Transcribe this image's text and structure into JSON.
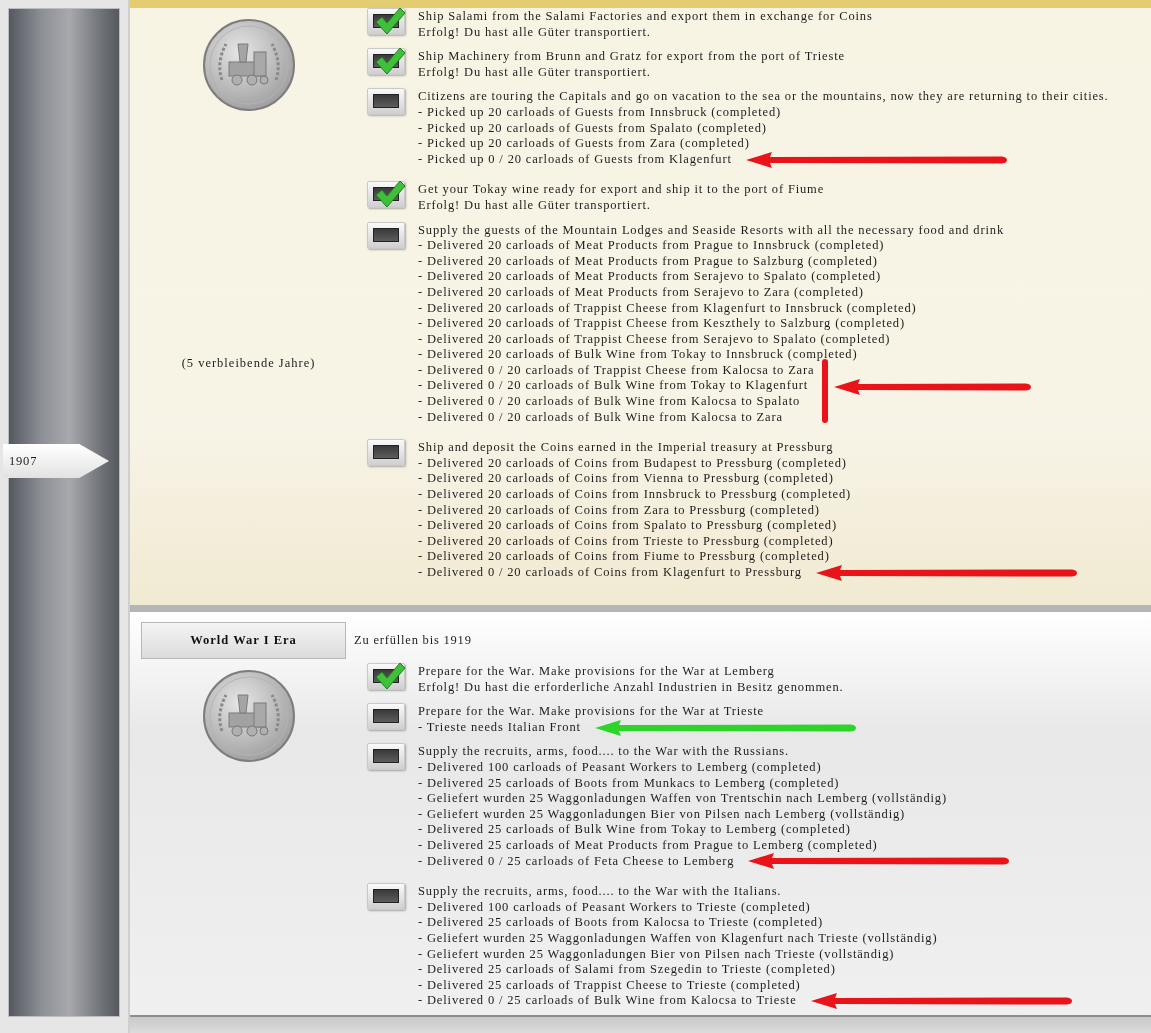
{
  "timeline": {
    "marker": "1907"
  },
  "eras": [
    {
      "selected": true,
      "remaining": "(5 verbleibende Jahre)",
      "goals": [
        {
          "checked": true,
          "title": "Ship Salami from the Salami Factories and export them in exchange for Coins",
          "lines": [
            {
              "text": "Erfolg! Du hast alle Güter transportiert."
            }
          ]
        },
        {
          "checked": true,
          "title": "Ship Machinery from Brunn and Gratz for export from the port of Trieste",
          "lines": [
            {
              "text": "Erfolg! Du hast alle Güter transportiert."
            }
          ]
        },
        {
          "checked": false,
          "title": "Citizens are touring the Capitals and go on vacation to the sea or the mountains, now they are returning to their cities.",
          "lines": [
            {
              "text": "- Picked up 20 carloads of Guests from Innsbruck (completed)"
            },
            {
              "text": "- Picked up 20 carloads of Guests from Spalato (completed)"
            },
            {
              "text": "- Picked up 20 carloads of Guests from Zara (completed)"
            },
            {
              "text": "- Picked up 0 / 20 carloads of Guests from Klagenfurt",
              "arrow": {
                "kind": "plain",
                "color": "#e8141a"
              }
            }
          ]
        },
        {
          "checked": true,
          "title": "Get your Tokay wine ready for export and ship it to the port of Fiume",
          "lines": [
            {
              "text": "Erfolg! Du hast alle Güter transportiert."
            }
          ]
        },
        {
          "checked": false,
          "title": "Supply the guests of the Mountain Lodges and Seaside Resorts with all the necessary food and drink",
          "lines": [
            {
              "text": "- Delivered 20 carloads of Meat Products from Prague to Innsbruck (completed)"
            },
            {
              "text": "- Delivered 20 carloads of Meat Products from Prague to Salzburg (completed)"
            },
            {
              "text": "- Delivered 20 carloads of Meat Products from Serajevo to Spalato (completed)"
            },
            {
              "text": "- Delivered 20 carloads of Meat Products from Serajevo to Zara (completed)"
            },
            {
              "text": "- Delivered 20 carloads of Trappist Cheese from Klagenfurt to Innsbruck (completed)"
            },
            {
              "text": "- Delivered 20 carloads of Trappist Cheese from Keszthely to Salzburg (completed)"
            },
            {
              "text": "- Delivered 20 carloads of Trappist Cheese from Serajevo to Spalato (completed)"
            },
            {
              "text": "- Delivered 20 carloads of Bulk Wine from Tokay to Innsbruck (completed)"
            },
            {
              "text": "- Delivered 0 / 20 carloads of Trappist Cheese from Kalocsa to Zara",
              "arrow": {
                "kind": "bracket",
                "color": "#e8141a"
              }
            },
            {
              "text": "- Delivered 0 / 20 carloads of Bulk Wine from Tokay to Klagenfurt"
            },
            {
              "text": "- Delivered 0 / 20 carloads of Bulk Wine from Kalocsa to Spalato"
            },
            {
              "text": "- Delivered 0 / 20 carloads of Bulk Wine from Kalocsa to Zara"
            }
          ]
        },
        {
          "checked": false,
          "title": "Ship and deposit the Coins earned in the Imperial treasury at Pressburg",
          "lines": [
            {
              "text": "- Delivered 20 carloads of Coins from Budapest to Pressburg (completed)"
            },
            {
              "text": "- Delivered 20 carloads of Coins from Vienna to Pressburg (completed)"
            },
            {
              "text": "- Delivered 20 carloads of Coins from Innsbruck to Pressburg (completed)"
            },
            {
              "text": "- Delivered 20 carloads of Coins from Zara to Pressburg (completed)"
            },
            {
              "text": "- Delivered 20 carloads of Coins from Spalato to Pressburg (completed)"
            },
            {
              "text": "- Delivered 20 carloads of Coins from Trieste to Pressburg (completed)"
            },
            {
              "text": "- Delivered 20 carloads of Coins from Fiume to Pressburg (completed)"
            },
            {
              "text": "- Delivered 0 / 20 carloads of Coins from Klagenfurt to Pressburg",
              "arrow": {
                "kind": "plain",
                "color": "#e8141a"
              }
            }
          ]
        }
      ]
    },
    {
      "selected": false,
      "title": "World War I Era",
      "deadline": "Zu erfüllen bis 1919",
      "goals": [
        {
          "checked": true,
          "title": "Prepare for the War. Make provisions for the War at Lemberg",
          "lines": [
            {
              "text": "Erfolg! Du hast die erforderliche Anzahl Industrien in Besitz genommen."
            }
          ]
        },
        {
          "checked": false,
          "title": "Prepare for the War. Make provisions for the War at Trieste",
          "lines": [
            {
              "text": "- Trieste needs Italian Front",
              "arrow": {
                "kind": "plain",
                "color": "#2ed42a"
              }
            }
          ]
        },
        {
          "checked": false,
          "title": "Supply the recruits, arms, food.... to the War with the Russians.",
          "lines": [
            {
              "text": "- Delivered 100 carloads of Peasant Workers to Lemberg (completed)"
            },
            {
              "text": "- Delivered 25 carloads of Boots from Munkacs to Lemberg (completed)"
            },
            {
              "text": "- Geliefert wurden 25 Waggonladungen Waffen von Trentschin nach Lemberg (vollständig)"
            },
            {
              "text": "- Geliefert wurden 25 Waggonladungen Bier von Pilsen nach Lemberg (vollständig)"
            },
            {
              "text": "- Delivered 25 carloads of Bulk Wine from Tokay to Lemberg (completed)"
            },
            {
              "text": "- Delivered 25 carloads of Meat Products from Prague to Lemberg (completed)"
            },
            {
              "text": "- Delivered 0 / 25 carloads of Feta Cheese to Lemberg",
              "arrow": {
                "kind": "plain",
                "color": "#e8141a"
              }
            }
          ]
        },
        {
          "checked": false,
          "title": "Supply the recruits, arms, food.... to the War with the Italians.",
          "lines": [
            {
              "text": "- Delivered 100 carloads of Peasant Workers to Trieste (completed)"
            },
            {
              "text": "- Delivered 25 carloads of Boots from Kalocsa to Trieste (completed)"
            },
            {
              "text": "- Geliefert wurden 25 Waggonladungen Waffen von Klagenfurt nach Trieste (vollständig)"
            },
            {
              "text": "- Geliefert wurden 25 Waggonladungen Bier von Pilsen nach Trieste (vollständig)"
            },
            {
              "text": "- Delivered 25 carloads of Salami from Szegedin to Trieste (completed)"
            },
            {
              "text": "- Delivered 25 carloads of Trappist Cheese to Trieste (completed)"
            },
            {
              "text": "- Delivered 0 / 25 carloads of Bulk Wine from Kalocsa to Trieste",
              "arrow": {
                "kind": "plain",
                "color": "#e8141a"
              }
            }
          ]
        }
      ]
    }
  ]
}
